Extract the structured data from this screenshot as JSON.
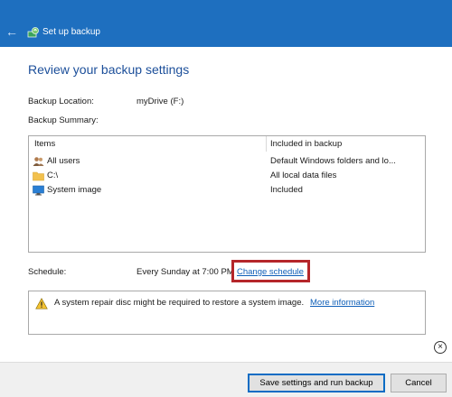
{
  "window": {
    "title": "Set up backup"
  },
  "heading": "Review your backup settings",
  "backup_location": {
    "label": "Backup Location:",
    "value": "myDrive (F:)"
  },
  "backup_summary_label": "Backup Summary:",
  "table": {
    "columns": [
      "Items",
      "Included in backup"
    ],
    "rows": [
      {
        "icon": "users-icon",
        "name": "All users",
        "included": "Default Windows folders and lo..."
      },
      {
        "icon": "folder-icon",
        "name": "C:\\",
        "included": "All local data files"
      },
      {
        "icon": "monitor-icon",
        "name": "System image",
        "included": "Included"
      }
    ]
  },
  "schedule": {
    "label": "Schedule:",
    "value": "Every Sunday at 7:00 PM",
    "link": "Change schedule"
  },
  "notice": {
    "text": "A system repair disc might be required to restore a system image.",
    "link": "More information"
  },
  "buttons": {
    "primary": "Save settings and run backup",
    "cancel": "Cancel"
  },
  "colors": {
    "titlebar": "#1e6fbf",
    "heading": "#1c4f9a",
    "link": "#0f5fb8",
    "highlight_border": "#b5262a"
  }
}
